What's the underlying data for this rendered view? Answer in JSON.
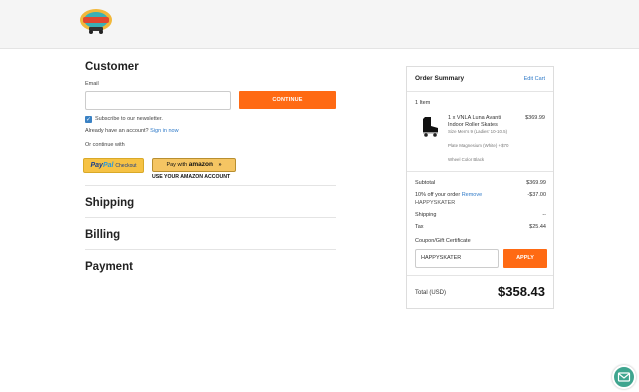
{
  "header": {
    "logo_icon": "roller-skate-shop-logo"
  },
  "customer": {
    "title": "Customer",
    "email_label": "Email",
    "email_value": "",
    "continue_label": "CONTINUE",
    "newsletter_checked": true,
    "newsletter_label": "Subscribe to our newsletter.",
    "account_prompt": "Already have an account?",
    "sign_in_label": "Sign in now",
    "or_continue": "Or continue with"
  },
  "payment_buttons": {
    "paypal_pay": "Pay",
    "paypal_pal": "Pal",
    "paypal_checkout": "Checkout",
    "amazon_prefix": "Pay with",
    "amazon_word": "amazon",
    "amazon_arrows": "»",
    "amazon_note": "USE YOUR AMAZON ACCOUNT"
  },
  "sections": {
    "shipping": "Shipping",
    "billing": "Billing",
    "payment": "Payment"
  },
  "summary": {
    "title": "Order Summary",
    "edit_cart": "Edit Cart",
    "items_count": "1 Item",
    "item": {
      "name": "1 x VNLA Luna Avanti Indoor Roller Skates",
      "price": "$369.99",
      "options": [
        "Size Men's 9 (Ladies' 10-10.5)",
        "Plate Magnesium (White) +$70",
        "Wheel Color Black"
      ]
    },
    "subtotal_label": "Subtotal",
    "subtotal_value": "$369.99",
    "discount_prefix": "10% off your order",
    "discount_remove": "Remove",
    "discount_value": "-$37.00",
    "discount_code": "HAPPYSKATER",
    "shipping_label": "Shipping",
    "shipping_value": "--",
    "tax_label": "Tax",
    "tax_value": "$25.44",
    "coupon_label": "Coupon/Gift Certificate",
    "coupon_value": "HAPPYSKATER",
    "apply_label": "APPLY",
    "total_label": "Total (USD)",
    "total_value": "$358.43"
  },
  "chat": {
    "icon": "envelope-icon"
  },
  "colors": {
    "accent": "#ff6a13",
    "link": "#2f7ac8",
    "chat": "#3fa58f"
  }
}
